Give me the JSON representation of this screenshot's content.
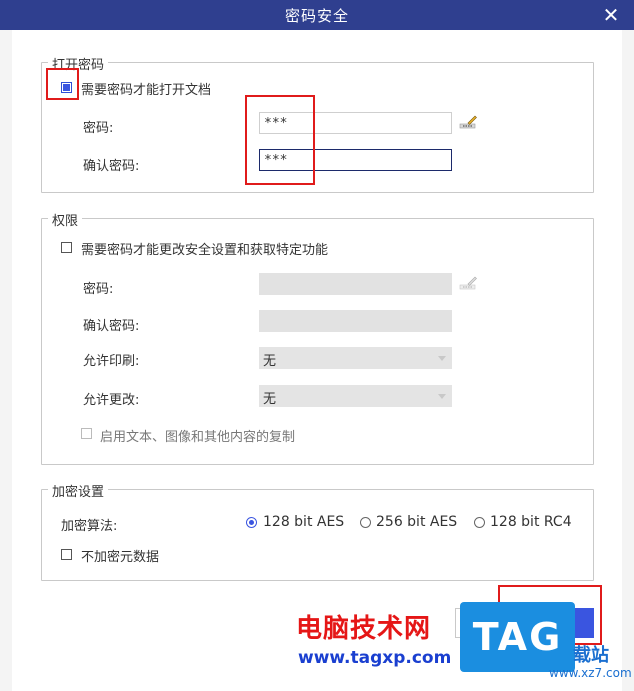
{
  "window": {
    "title": "密码安全",
    "close_glyph": "✕"
  },
  "open_password": {
    "legend": "打开密码",
    "require_label": "需要密码才能打开文档",
    "require_checked": true,
    "password_label": "密码:",
    "password_value": "***",
    "confirm_label": "确认密码:",
    "confirm_value": "***"
  },
  "permissions": {
    "legend": "权限",
    "require_label": "需要密码才能更改安全设置和获取特定功能",
    "require_checked": false,
    "password_label": "密码:",
    "password_value": "",
    "confirm_label": "确认密码:",
    "confirm_value": "",
    "print_label": "允许印刷:",
    "print_value": "无",
    "change_label": "允许更改:",
    "change_value": "无",
    "copy_label": "启用文本、图像和其他内容的复制"
  },
  "encryption": {
    "legend": "加密设置",
    "algorithm_label": "加密算法:",
    "options": [
      {
        "label": "128 bit AES",
        "selected": true
      },
      {
        "label": "256 bit AES",
        "selected": false
      },
      {
        "label": "128 bit RC4",
        "selected": false
      }
    ],
    "no_metadata_label": "不加密元数据",
    "no_metadata_checked": false
  },
  "watermark": {
    "site_name": "电脑技术网",
    "url": "www.tagxp.com",
    "logo": "TAG",
    "right_text": "载站",
    "right_url": "www.xz7.com"
  },
  "colors": {
    "titlebar": "#2f3f8f",
    "accent": "#3a55e0",
    "highlight": "#e01b1b"
  }
}
